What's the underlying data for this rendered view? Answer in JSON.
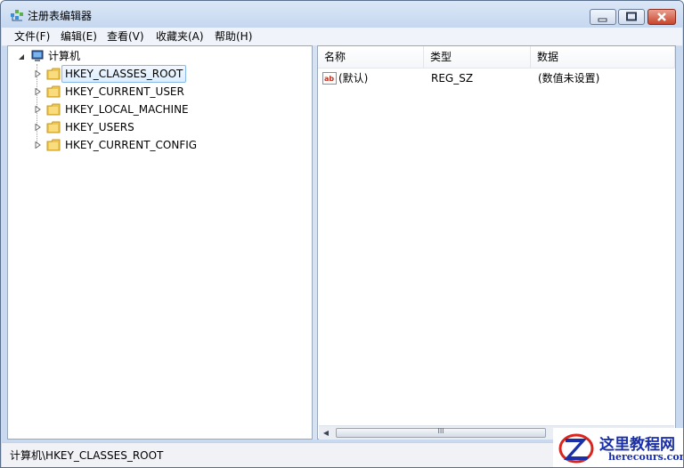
{
  "window": {
    "title": "注册表编辑器"
  },
  "menu": [
    {
      "label": "文件(F)"
    },
    {
      "label": "编辑(E)"
    },
    {
      "label": "查看(V)"
    },
    {
      "label": "收藏夹(A)"
    },
    {
      "label": "帮助(H)"
    }
  ],
  "tree": {
    "root": "计算机",
    "items": [
      {
        "label": "HKEY_CLASSES_ROOT",
        "selected": true
      },
      {
        "label": "HKEY_CURRENT_USER"
      },
      {
        "label": "HKEY_LOCAL_MACHINE"
      },
      {
        "label": "HKEY_USERS"
      },
      {
        "label": "HKEY_CURRENT_CONFIG"
      }
    ]
  },
  "list": {
    "columns": [
      "名称",
      "类型",
      "数据"
    ],
    "rows": [
      {
        "name": "(默认)",
        "type": "REG_SZ",
        "data": "(数值未设置)",
        "icon": "string-value-icon"
      }
    ]
  },
  "scrollbar": {
    "thumb_glyph": "III"
  },
  "status": {
    "path": "计算机\\HKEY_CLASSES_ROOT"
  },
  "watermark": {
    "title": "这里教程网",
    "url": "herecours.com"
  },
  "colors": {
    "title_bg": "#c5d7ef",
    "selection": "#dceeff",
    "close_button": "#c8462c",
    "folder": "#f0c64a",
    "watermark": "#1a2fa8"
  }
}
